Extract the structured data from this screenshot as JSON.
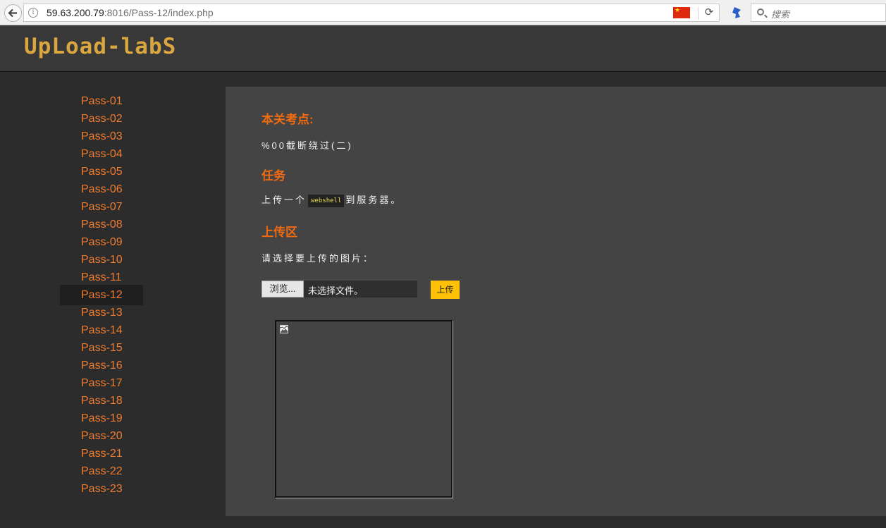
{
  "browser": {
    "url_host": "59.63.200.79",
    "url_path": ":8016/Pass-12/index.php",
    "search_placeholder": "搜索",
    "icons": [
      "back-arrow-icon",
      "info-icon",
      "china-flag-icon",
      "reload-icon",
      "extension-icon",
      "search-icon"
    ]
  },
  "header": {
    "logo_text": "UpLoad-labS"
  },
  "sidebar": {
    "items": [
      {
        "label": "Pass-01"
      },
      {
        "label": "Pass-02"
      },
      {
        "label": "Pass-03"
      },
      {
        "label": "Pass-04"
      },
      {
        "label": "Pass-05"
      },
      {
        "label": "Pass-06"
      },
      {
        "label": "Pass-07"
      },
      {
        "label": "Pass-08"
      },
      {
        "label": "Pass-09"
      },
      {
        "label": "Pass-10"
      },
      {
        "label": "Pass-11"
      },
      {
        "label": "Pass-12",
        "active": true
      },
      {
        "label": "Pass-13"
      },
      {
        "label": "Pass-14"
      },
      {
        "label": "Pass-15"
      },
      {
        "label": "Pass-16"
      },
      {
        "label": "Pass-17"
      },
      {
        "label": "Pass-18"
      },
      {
        "label": "Pass-19"
      },
      {
        "label": "Pass-20"
      },
      {
        "label": "Pass-21"
      },
      {
        "label": "Pass-22"
      },
      {
        "label": "Pass-23"
      }
    ]
  },
  "main": {
    "point_title": "本关考点:",
    "point_text": "%00截断绕过(二)",
    "task_title": "任务",
    "task_text_before": "上传一个",
    "task_code": "webshell",
    "task_text_after": "到服务器。",
    "upload_title": "上传区",
    "upload_prompt": "请选择要上传的图片：",
    "browse_label": "浏览...",
    "no_file_label": "未选择文件。",
    "upload_button": "上传"
  },
  "colors": {
    "accent_orange": "#f06a10",
    "link_orange": "#f07c30",
    "upload_yellow": "#ffc107",
    "logo_gold": "#d9a640"
  }
}
